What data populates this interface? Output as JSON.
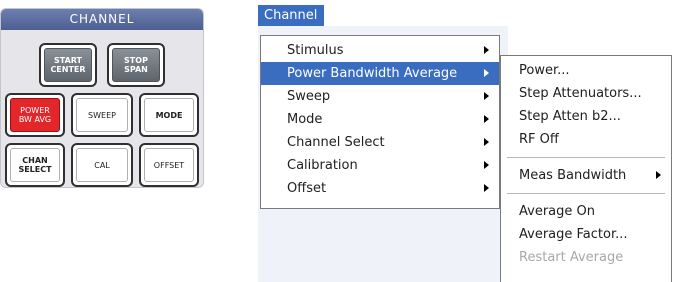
{
  "panel": {
    "title": "CHANNEL",
    "keys": {
      "start_center": "START\nCENTER",
      "stop_span": "STOP\nSPAN",
      "power_bw_avg": "POWER\nBW AVG",
      "sweep": "SWEEP",
      "mode": "MODE",
      "chan_select": "CHAN\nSELECT",
      "cal": "CAL",
      "offset": "OFFSET"
    },
    "colors": {
      "active_key": "#e2262a",
      "header": "#4d5f90"
    }
  },
  "menubar": {
    "channel_label": "Channel"
  },
  "main_menu": {
    "items": [
      {
        "label": "Stimulus",
        "submenu": true
      },
      {
        "label": "Power Bandwidth Average",
        "submenu": true,
        "selected": true
      },
      {
        "label": "Sweep",
        "submenu": true
      },
      {
        "label": "Mode",
        "submenu": true
      },
      {
        "label": "Channel Select",
        "submenu": true
      },
      {
        "label": "Calibration",
        "submenu": true
      },
      {
        "label": "Offset",
        "submenu": true
      }
    ]
  },
  "sub_menu": {
    "items": [
      {
        "label": "Power..."
      },
      {
        "label": "Step Attenuators..."
      },
      {
        "label": "Step Atten b2..."
      },
      {
        "label": "RF Off"
      },
      {
        "label": "Meas Bandwidth",
        "submenu": true
      },
      {
        "label": "Average On"
      },
      {
        "label": "Average Factor..."
      },
      {
        "label": "Restart Average",
        "disabled": true
      }
    ]
  },
  "colors": {
    "selection": "#3a6dc0",
    "menu_area_bg": "#eff3f9"
  }
}
